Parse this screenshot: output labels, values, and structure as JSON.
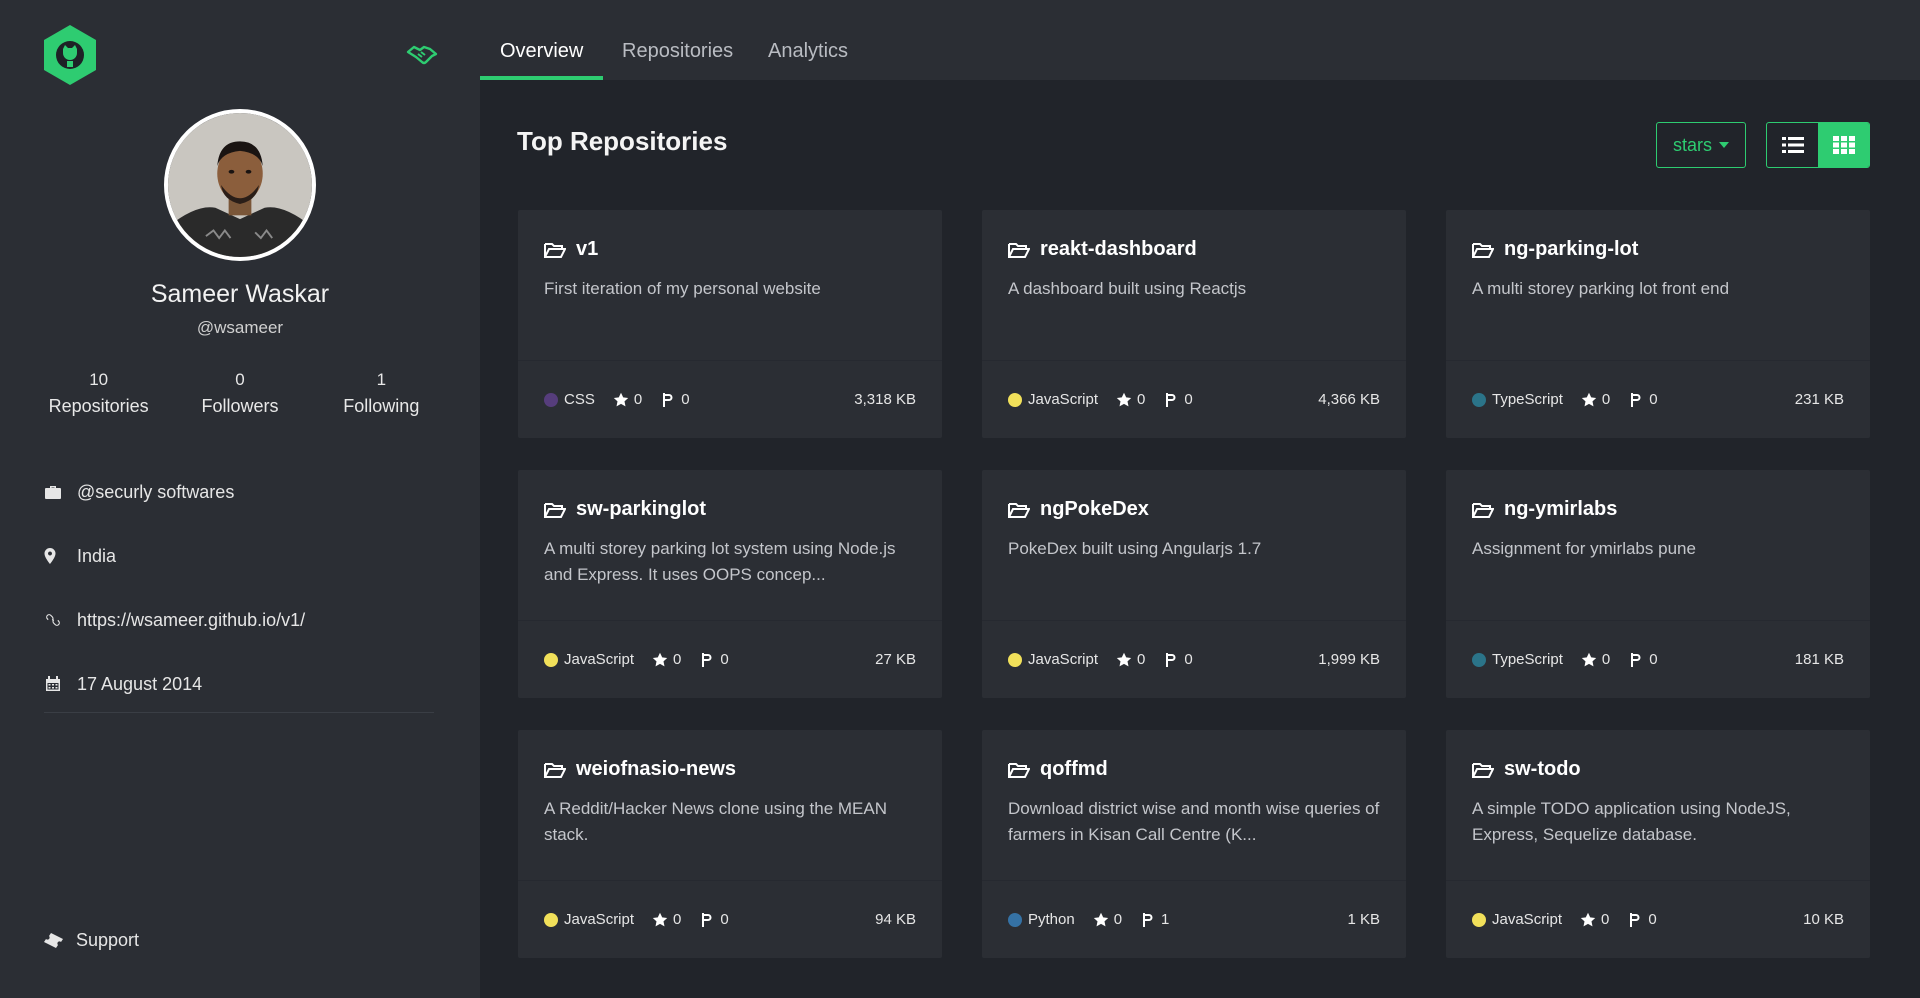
{
  "colors": {
    "accent": "#2ecc71",
    "background": "#21242a",
    "panel": "#2b2e34"
  },
  "sidebar": {
    "logo_icon": "github-hexagon-logo",
    "top_right_icon": "handshake-icon",
    "profile": {
      "name": "Sameer Waskar",
      "login": "@wsameer"
    },
    "stats": [
      {
        "value": "10",
        "label": "Repositories"
      },
      {
        "value": "0",
        "label": "Followers"
      },
      {
        "value": "1",
        "label": "Following"
      }
    ],
    "info": [
      {
        "icon": "briefcase-icon",
        "text": "@securly softwares"
      },
      {
        "icon": "map-pin-icon",
        "text": "India"
      },
      {
        "icon": "link-icon",
        "text": "https://wsameer.github.io/v1/"
      },
      {
        "icon": "calendar-icon",
        "text": "17 August 2014"
      }
    ],
    "support_label": "Support"
  },
  "nav": {
    "tabs": [
      "Overview",
      "Repositories",
      "Analytics"
    ],
    "active": "Overview"
  },
  "main": {
    "title": "Top Repositories",
    "sort_label": "stars",
    "view_modes": [
      "list-icon",
      "grid-icon"
    ]
  },
  "language_colors": {
    "CSS": "#563d7c",
    "JavaScript": "#f1e05a",
    "TypeScript": "#2b7489",
    "Python": "#3572a5"
  },
  "repos": [
    {
      "name": "v1",
      "description": "First iteration of my personal website",
      "language": "CSS",
      "stars": "0",
      "forks": "0",
      "size": "3,318 KB"
    },
    {
      "name": "reakt-dashboard",
      "description": "A dashboard built using Reactjs",
      "language": "JavaScript",
      "stars": "0",
      "forks": "0",
      "size": "4,366 KB"
    },
    {
      "name": "ng-parking-lot",
      "description": "A multi storey parking lot front end",
      "language": "TypeScript",
      "stars": "0",
      "forks": "0",
      "size": "231 KB"
    },
    {
      "name": "sw-parkinglot",
      "description": "A multi storey parking lot system using Node.js and Express. It uses OOPS concep...",
      "language": "JavaScript",
      "stars": "0",
      "forks": "0",
      "size": "27 KB"
    },
    {
      "name": "ngPokeDex",
      "description": "PokeDex built using Angularjs 1.7",
      "language": "JavaScript",
      "stars": "0",
      "forks": "0",
      "size": "1,999 KB"
    },
    {
      "name": "ng-ymirlabs",
      "description": "Assignment for ymirlabs pune",
      "language": "TypeScript",
      "stars": "0",
      "forks": "0",
      "size": "181 KB"
    },
    {
      "name": "weiofnasio-news",
      "description": "A Reddit/Hacker News clone using the MEAN stack.",
      "language": "JavaScript",
      "stars": "0",
      "forks": "0",
      "size": "94 KB"
    },
    {
      "name": "qoffmd",
      "description": "Download district wise and month wise queries of farmers in Kisan Call Centre (K...",
      "language": "Python",
      "stars": "0",
      "forks": "1",
      "size": "1 KB"
    },
    {
      "name": "sw-todo",
      "description": "A simple TODO application using NodeJS, Express, Sequelize database.",
      "language": "JavaScript",
      "stars": "0",
      "forks": "0",
      "size": "10 KB"
    }
  ]
}
